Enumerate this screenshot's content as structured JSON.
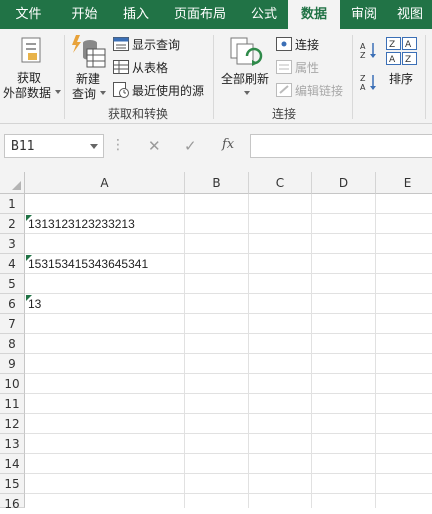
{
  "tabs": [
    "文件",
    "开始",
    "插入",
    "页面布局",
    "公式",
    "数据",
    "审阅",
    "视图"
  ],
  "active_tab": "数据",
  "ribbon": {
    "get_external_data": [
      "获取",
      "外部数据"
    ],
    "new_query": [
      "新建",
      "查询"
    ],
    "show_queries": "显示查询",
    "from_table": "从表格",
    "recent_sources": "最近使用的源",
    "group_get_transform": "获取和转换",
    "refresh_all": "全部刷新",
    "connections": "连接",
    "properties": "属性",
    "edit_links": "编辑链接",
    "group_connections": "连接",
    "sort": "排序"
  },
  "formula_bar": {
    "name_box": "B11",
    "fx": "fx",
    "cancel": "✕",
    "enter": "✓",
    "value": ""
  },
  "columns": [
    "A",
    "B",
    "C",
    "D",
    "E"
  ],
  "rows": [
    "1",
    "2",
    "3",
    "4",
    "5",
    "6",
    "7",
    "8",
    "9",
    "10",
    "11",
    "12",
    "13",
    "14",
    "15",
    "16"
  ],
  "cells": {
    "A2": "1313123123233213",
    "A4": "153153415343645341",
    "A6": "13"
  },
  "colors": {
    "excel_green": "#217346"
  }
}
